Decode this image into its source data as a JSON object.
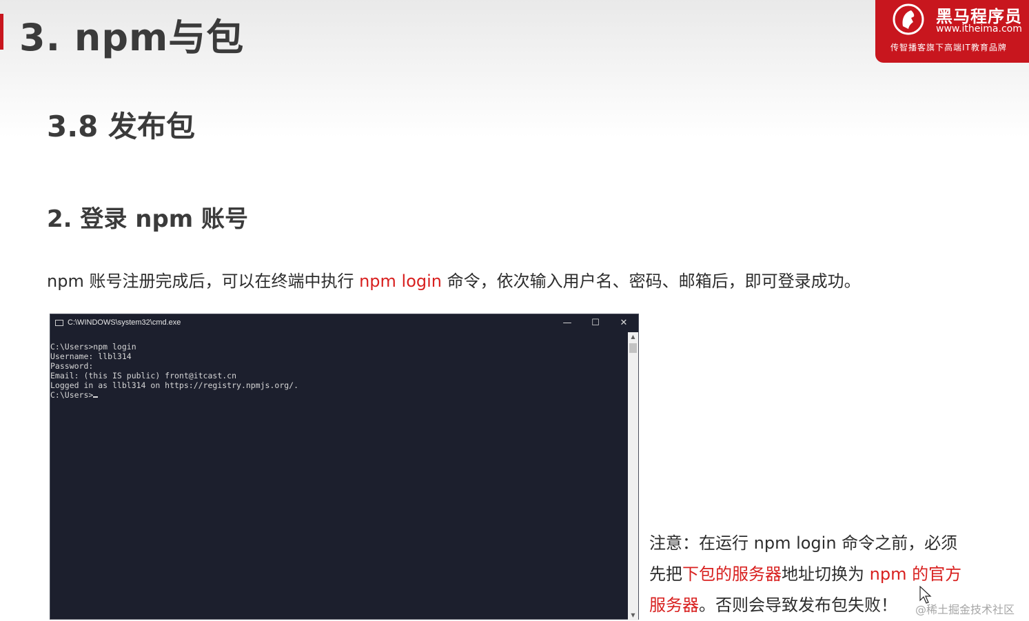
{
  "slide": {
    "title": "3. npm与包"
  },
  "logo": {
    "name": "黑马程序员",
    "url": "www.itheima.com",
    "tagline": "传智播客旗下高端IT教育品牌",
    "icon": "horse-head-icon"
  },
  "section": {
    "title": "3.8 发布包",
    "subtitle": "2. 登录 npm 账号"
  },
  "intro": {
    "before": "npm 账号注册完成后，可以在终端中执行 ",
    "command": "npm login",
    "after": " 命令，依次输入用户名、密码、邮箱后，即可登录成功。"
  },
  "cmd": {
    "title": "C:\\WINDOWS\\system32\\cmd.exe",
    "lines": [
      "C:\\Users>npm login",
      "Username: llbl314",
      "Password:",
      "Email: (this IS public) front@itcast.cn",
      "Logged in as llbl314 on https://registry.npmjs.org/.",
      "",
      "C:\\Users>"
    ],
    "buttons": {
      "minimize": "—",
      "maximize": "☐",
      "close": "✕"
    },
    "scroll": {
      "up": "▲",
      "down": "▼"
    }
  },
  "note": {
    "line1": "注意：在运行 npm login 命令之前，必须",
    "line2_pre": "先把",
    "line2_red1": "下包的服务器",
    "line2_mid": "地址切换为 ",
    "line2_red2": "npm 的官方",
    "line3_red": "服务器",
    "line3_post": "。否则会导致发布包失败！"
  },
  "watermark": "@稀土掘金技术社区",
  "colors": {
    "accent": "#c8161e",
    "highlight": "#d8201f",
    "terminal_bg": "#1c1f2d",
    "text": "#2d2d2d"
  }
}
